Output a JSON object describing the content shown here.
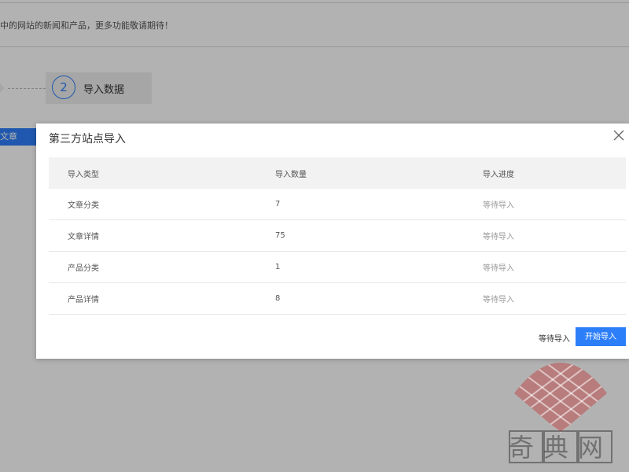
{
  "background": {
    "notice_text": "中的网站的新闻和产品，更多功能敬请期待！",
    "step": {
      "number": "2",
      "label": "导入数据"
    },
    "side_tab_label": "文章"
  },
  "modal": {
    "title": "第三方站点导入",
    "table": {
      "headers": [
        "导入类型",
        "导入数量",
        "导入进度"
      ],
      "rows": [
        {
          "type": "文章分类",
          "count": "7",
          "status": "等待导入"
        },
        {
          "type": "文章详情",
          "count": "75",
          "status": "等待导入"
        },
        {
          "type": "产品分类",
          "count": "1",
          "status": "等待导入"
        },
        {
          "type": "产品详情",
          "count": "8",
          "status": "等待导入"
        }
      ]
    },
    "footer": {
      "status_text": "等待导入",
      "start_button": "开始导入"
    }
  },
  "watermark": {
    "text": "奇典网"
  },
  "colors": {
    "accent": "#2d7ff9",
    "overlay": "rgba(0,0,0,0.30)",
    "header_bg": "#f2f2f2"
  }
}
